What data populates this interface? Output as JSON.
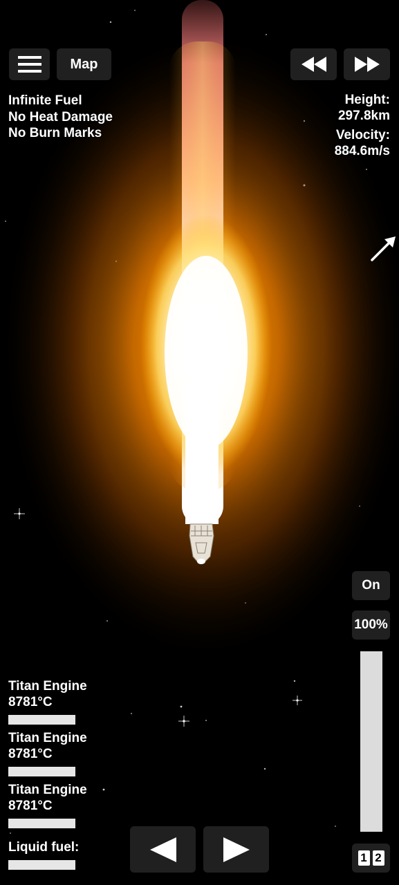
{
  "top_bar": {
    "map_label": "Map",
    "menu_icon": "hamburger-menu-icon",
    "rewind_icon": "rewind-icon",
    "fast_forward_icon": "fast-forward-icon"
  },
  "cheats": [
    "Infinite Fuel",
    "No Heat Damage",
    "No Burn Marks"
  ],
  "telemetry": {
    "height_label": "Height:",
    "height_value": "297.8km",
    "velocity_label": "Velocity:",
    "velocity_value": "884.6m/s"
  },
  "direction_indicator_icon": "direction-arrow-icon",
  "engines": [
    {
      "name": "Titan Engine",
      "temp": "8781°C",
      "level": 1.0
    },
    {
      "name": "Titan Engine",
      "temp": "8781°C",
      "level": 1.0
    },
    {
      "name": "Titan Engine",
      "temp": "8781°C",
      "level": 1.0
    }
  ],
  "fuel": {
    "label": "Liquid fuel:",
    "level": 1.0
  },
  "throttle": {
    "on_label": "On",
    "percent_label": "100%",
    "level": 1.0
  },
  "controls": {
    "left_icon": "rotate-left-icon",
    "right_icon": "rotate-right-icon"
  },
  "stage_icons": {
    "one": "1",
    "two": "2"
  },
  "colors": {
    "flame_core": "#ffffff",
    "flame_glow": "#ff9a00",
    "exhaust": "#ff8080",
    "button_bg": "#262626"
  }
}
